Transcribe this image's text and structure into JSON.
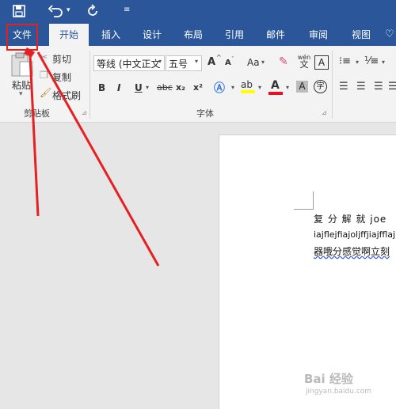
{
  "quick_access": {
    "save_icon": "save-icon",
    "undo_icon": "undo-icon",
    "redo_icon": "redo-icon",
    "customize_icon": "customize-icon"
  },
  "tabs": [
    {
      "label": "文件"
    },
    {
      "label": "开始"
    },
    {
      "label": "插入"
    },
    {
      "label": "设计"
    },
    {
      "label": "布局"
    },
    {
      "label": "引用"
    },
    {
      "label": "邮件"
    },
    {
      "label": "审阅"
    },
    {
      "label": "视图"
    }
  ],
  "clipboard": {
    "paste": "粘贴",
    "cut": "剪切",
    "copy": "复制",
    "format_painter": "格式刷",
    "group": "剪贴板"
  },
  "font": {
    "font_name": "等线 (中文正文",
    "font_size": "五号",
    "group": "字体",
    "bold": "B",
    "italic": "I",
    "underline": "U",
    "strike": "abc",
    "subscript": "x₂",
    "superscript": "x²",
    "grow": "A",
    "shrink": "A",
    "case": "Aa",
    "highlight_color": "A",
    "font_color": "A"
  },
  "document": {
    "line1": "复 分 解 就  joe",
    "line2": "iajflejfiajoljffjiajfflajl",
    "line3": "器哦分感觉啊立刻"
  },
  "watermark": {
    "brand": "Bai 经验",
    "url": "jingyan.baidu.com"
  },
  "colors": {
    "ribbon_blue": "#2b579a",
    "annotation_red": "#e62020"
  }
}
